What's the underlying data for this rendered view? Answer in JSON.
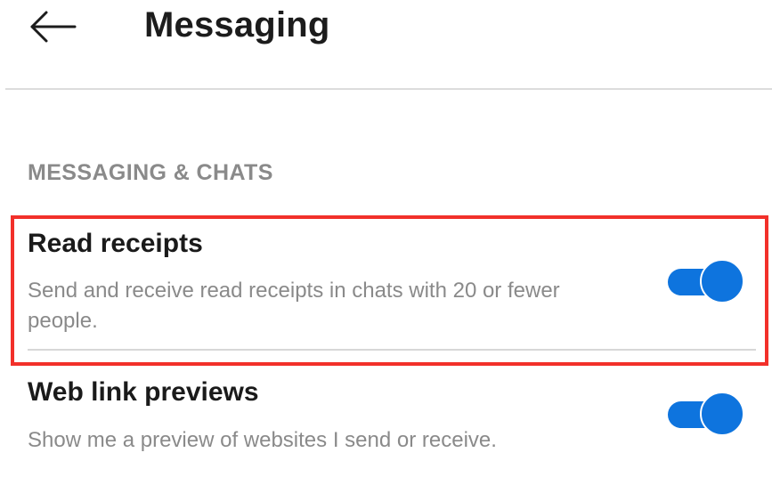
{
  "header": {
    "back_icon": "arrow-left-icon",
    "title": "Messaging"
  },
  "section": {
    "heading": "MESSAGING & CHATS"
  },
  "settings": [
    {
      "title": "Read receipts",
      "description": "Send and receive read receipts in chats with 20 or fewer people.",
      "enabled": true,
      "highlighted": true
    },
    {
      "title": "Web link previews",
      "description": "Show me a preview of websites I send or receive.",
      "enabled": true,
      "highlighted": false
    }
  ],
  "colors": {
    "toggle_on": "#0e74de",
    "highlight": "#f2302a",
    "title_text": "#1c1c1c",
    "secondary_text": "#8a8a8a"
  }
}
